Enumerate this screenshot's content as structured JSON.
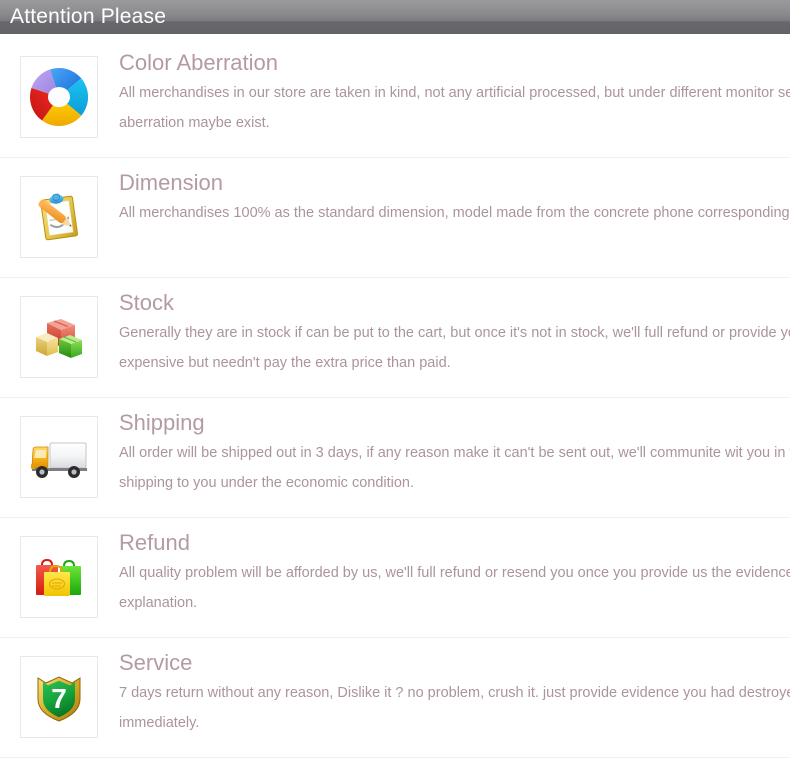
{
  "header": {
    "title": "Attention Please",
    "bg_top_color": "#9a9a9d",
    "bg_bottom_color": "#636368",
    "text_color": "#ffffff"
  },
  "theme": {
    "title_color": "#b49ba3",
    "body_color": "#ab949c",
    "divider_color": "#f2f0f1",
    "icon_border_color": "#e9e7e8",
    "page_bg": "#ffffff"
  },
  "items": [
    {
      "icon": "color-wheel-icon",
      "title": "Color Aberration",
      "description": "All merchandises in our store are taken in kind, not any artificial processed, but under different monitor set and light condition, some color aberration maybe exist."
    },
    {
      "icon": "clipboard-pencil-icon",
      "title": "Dimension",
      "description": "All merchandises 100% as the standard dimension, model made from the concrete phone correspondingly, not any deviation."
    },
    {
      "icon": "boxes-icon",
      "title": "Stock",
      "description": "Generally they are in stock if can be put to the cart, but once it's not in stock, we'll full refund or provide you more alternatives even more expensive but needn't pay the extra price than paid."
    },
    {
      "icon": "delivery-truck-icon",
      "title": "Shipping",
      "description": "All order will be shipped out in 3 days, if any reason make it can't be sent out, we'll communite wit you in time, we'll provide the most fast shipping to you under the economic condition."
    },
    {
      "icon": "shopping-bags-icon",
      "title": "Refund",
      "description": "All quality problem will be afforded by us, we'll full refund or resend you once you provide us the evidence like pictures or any credible explanation."
    },
    {
      "icon": "shield-seven-icon",
      "title": "Service",
      "description": "7 days return without any reason, Dislike it ? no problem, crush it. just provide evidence you had destroyed it, we'll full refund you immediately."
    }
  ]
}
